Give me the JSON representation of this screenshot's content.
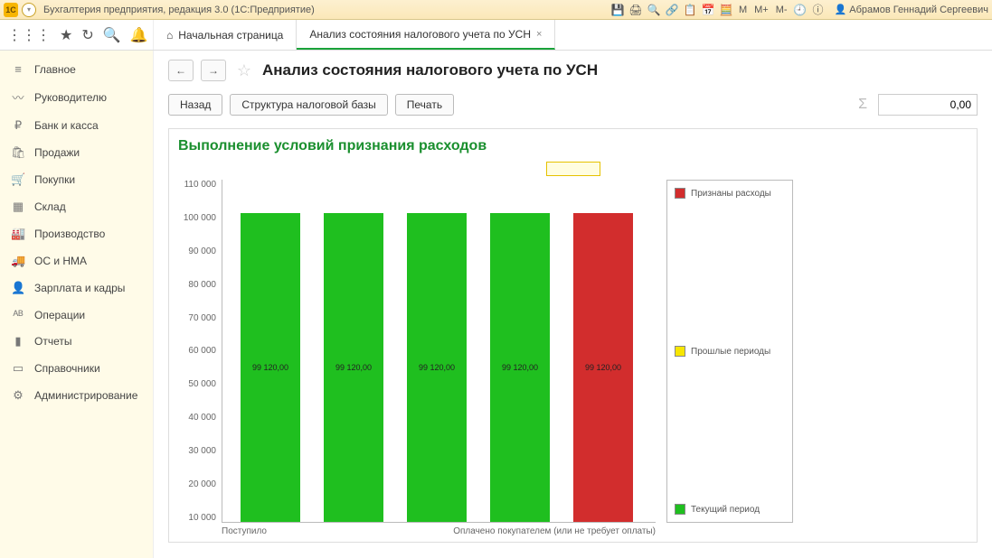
{
  "titlebar": {
    "app_title": "Бухгалтерия предприятия, редакция 3.0  (1С:Предприятие)",
    "user_name": "Абрамов Геннадий Сергеевич",
    "m_labels": [
      "M",
      "M+",
      "M-"
    ]
  },
  "tabs": {
    "home_label": "Начальная страница",
    "active_label": "Анализ состояния налогового учета по УСН"
  },
  "sidebar": {
    "items": [
      {
        "icon": "≡",
        "label": "Главное"
      },
      {
        "icon": "〰",
        "label": "Руководителю"
      },
      {
        "icon": "₽",
        "label": "Банк и касса"
      },
      {
        "icon": "🛍",
        "label": "Продажи"
      },
      {
        "icon": "🛒",
        "label": "Покупки"
      },
      {
        "icon": "▦",
        "label": "Склад"
      },
      {
        "icon": "🏭",
        "label": "Производство"
      },
      {
        "icon": "🚚",
        "label": "ОС и НМА"
      },
      {
        "icon": "👤",
        "label": "Зарплата и кадры"
      },
      {
        "icon": "ᴬᴮ",
        "label": "Операции"
      },
      {
        "icon": "▮",
        "label": "Отчеты"
      },
      {
        "icon": "▭",
        "label": "Справочники"
      },
      {
        "icon": "⚙",
        "label": "Администрирование"
      }
    ]
  },
  "page": {
    "title": "Анализ состояния налогового учета по УСН",
    "btn_back": "Назад",
    "btn_structure": "Структура налоговой базы",
    "btn_print": "Печать",
    "sum_value": "0,00"
  },
  "chart_data": {
    "type": "bar",
    "title": "Выполнение условий признания расходов",
    "ylim": [
      0,
      110000
    ],
    "yticks": [
      110000,
      100000,
      90000,
      80000,
      70000,
      60000,
      50000,
      40000,
      30000,
      20000,
      10000
    ],
    "ytick_labels": [
      "110 000",
      "100 000",
      "90 000",
      "80 000",
      "70 000",
      "60 000",
      "50 000",
      "40 000",
      "30 000",
      "20 000",
      "10 000"
    ],
    "bars": [
      {
        "value": 99120.0,
        "label": "99 120,00",
        "color": "#1fbf1f"
      },
      {
        "value": 99120.0,
        "label": "99 120,00",
        "color": "#1fbf1f"
      },
      {
        "value": 99120.0,
        "label": "99 120,00",
        "color": "#1fbf1f"
      },
      {
        "value": 99120.0,
        "label": "99 120,00",
        "color": "#1fbf1f"
      },
      {
        "value": 99120.0,
        "label": "99 120,00",
        "color": "#d22d2d"
      }
    ],
    "x_labels": {
      "left": "Поступило",
      "right": "Оплачено покупателем (или не требует оплаты)"
    },
    "legend": [
      {
        "color": "#d22d2d",
        "label": "Признаны расходы"
      },
      {
        "color": "#f7e600",
        "label": "Прошлые периоды"
      },
      {
        "color": "#1fbf1f",
        "label": "Текущий период"
      }
    ]
  }
}
